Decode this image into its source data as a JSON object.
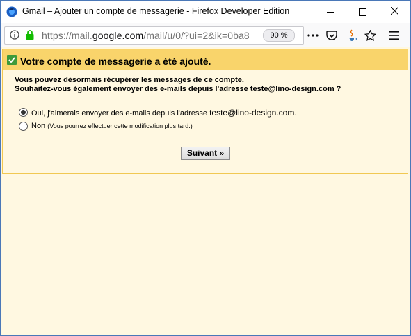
{
  "window": {
    "title": "Gmail – Ajouter un compte de messagerie - Firefox Developer Edition"
  },
  "urlbar": {
    "url_prefix": "https://mail.",
    "url_host": "google.com",
    "url_rest": "/mail/u/0/?ui=2&ik=0ba8",
    "zoom": "90 %"
  },
  "page": {
    "header": "Votre compte de messagerie a été ajouté.",
    "line1": "Vous pouvez désormais récupérer les messages de ce compte.",
    "line2": "Souhaitez-vous également envoyer des e-mails depuis l'adresse teste@lino-design.com ?",
    "option_yes_text": "Oui, j'aimerais envoyer des e-mails depuis l'adresse ",
    "option_yes_email": "teste@lino-design.com",
    "option_yes_end": ".",
    "option_no_text": "Non",
    "option_no_note": "(Vous pourrez effectuer cette modification plus tard.)",
    "next_button": "Suivant »"
  },
  "colors": {
    "header_bg": "#f9d46b",
    "page_bg": "#fff8e1",
    "border": "#f1c852",
    "check_green": "#3e9a3a"
  }
}
